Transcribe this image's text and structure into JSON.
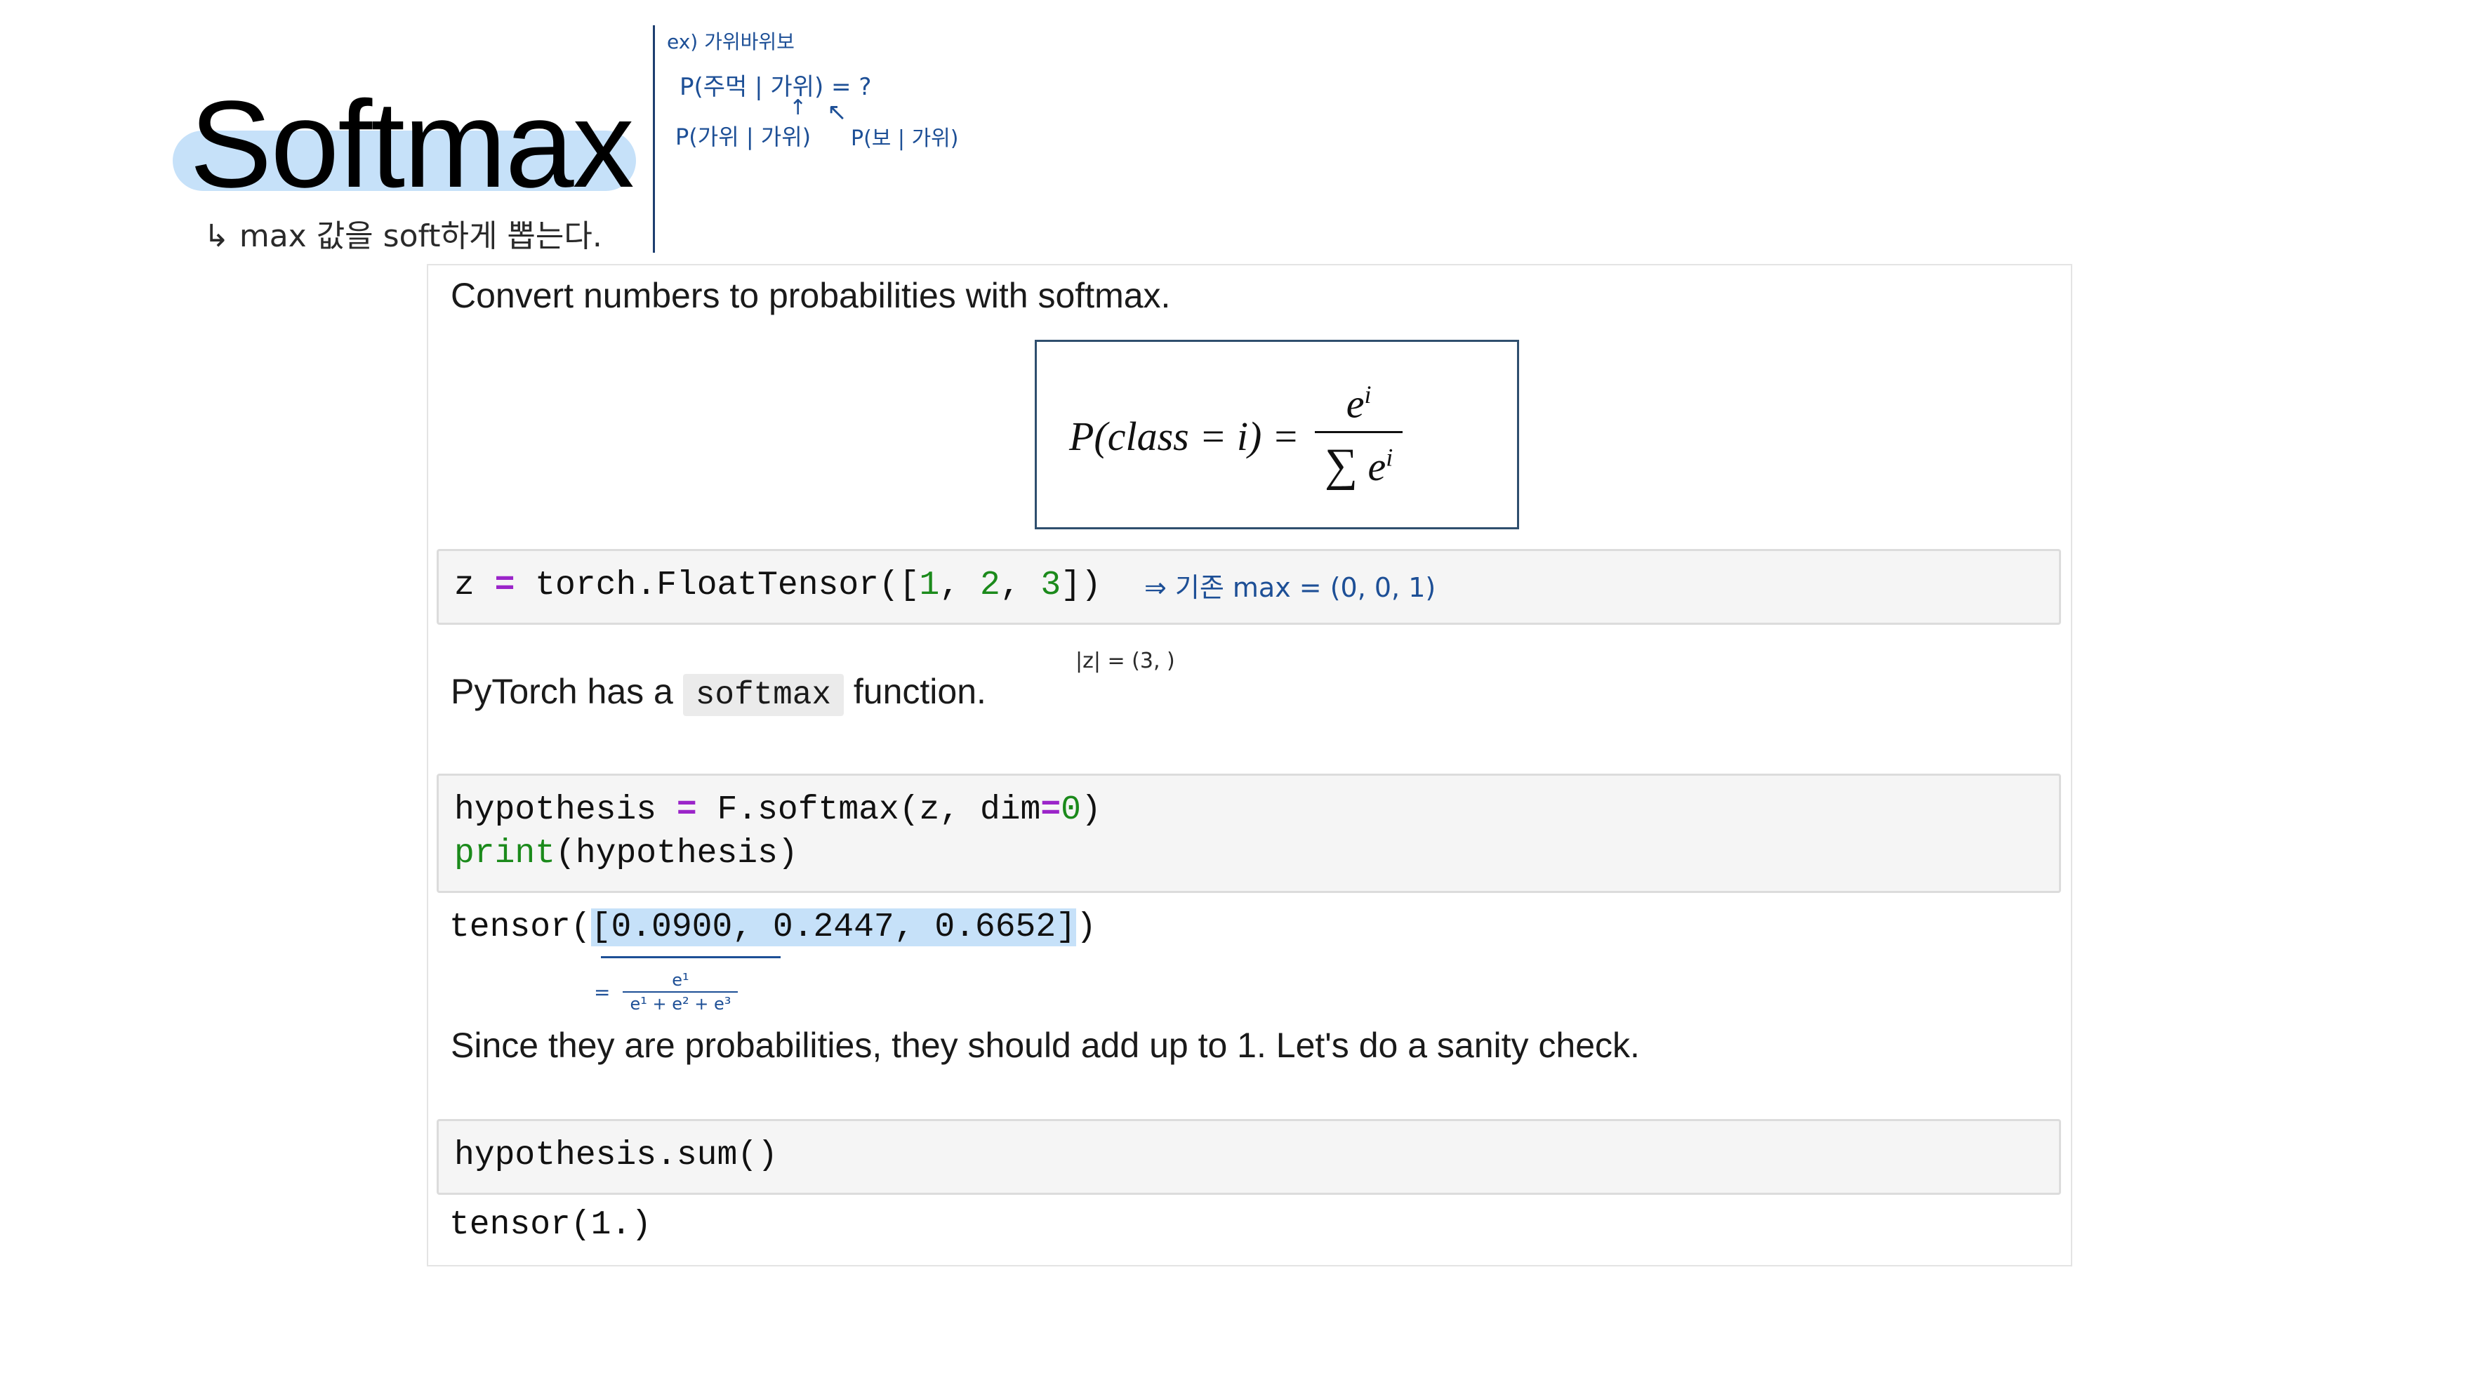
{
  "title": "Softmax",
  "notes": {
    "subtitle": "↳ max 값을 soft하게 뽑는다.",
    "ex_header": "ex) 가위바위보",
    "ex_query": "P(주먹 | 가위) = ?",
    "ex_given1": "P(가위 | 가위)",
    "ex_given2": "P(보 | 가위)",
    "arrow_up": "↑",
    "arrow_diag": "↖",
    "max_note": "⇒ 기존 max = (0, 0, 1)",
    "z_norm": "|z| = (3, )",
    "frac_eq": "=",
    "frac_num": "e¹",
    "frac_den": "e¹ + e² + e³"
  },
  "notebook": {
    "intro": "Convert numbers to probabilities with softmax.",
    "formula": {
      "lhs": "P(class = i) =",
      "num_base": "e",
      "num_exp": "i",
      "den_sum": "∑",
      "den_base": "e",
      "den_exp": "i"
    },
    "cell1": {
      "var": "z",
      "eq": "=",
      "call_open": "torch.FloatTensor([",
      "n1": "1",
      "sep1": ", ",
      "n2": "2",
      "sep2": ", ",
      "n3": "3",
      "call_close": "])"
    },
    "pytorch_pre": "PyTorch has a",
    "pytorch_code": "softmax",
    "pytorch_post": "function.",
    "cell2": {
      "line1_var": "hypothesis",
      "line1_eq": "=",
      "line1_call": "F.softmax(z, dim",
      "line1_eq2": "=",
      "line1_arg": "0",
      "line1_close": ")",
      "line2_fn": "print",
      "line2_rest": "(hypothesis)"
    },
    "out1_pre": "tensor(",
    "out1_values": "[0.0900, 0.2447, 0.6652]",
    "out1_post": ")",
    "sanity": "Since they are probabilities, they should add up to 1. Let's do a sanity check.",
    "cell3": "hypothesis.sum()",
    "out2": "tensor(1.)"
  }
}
